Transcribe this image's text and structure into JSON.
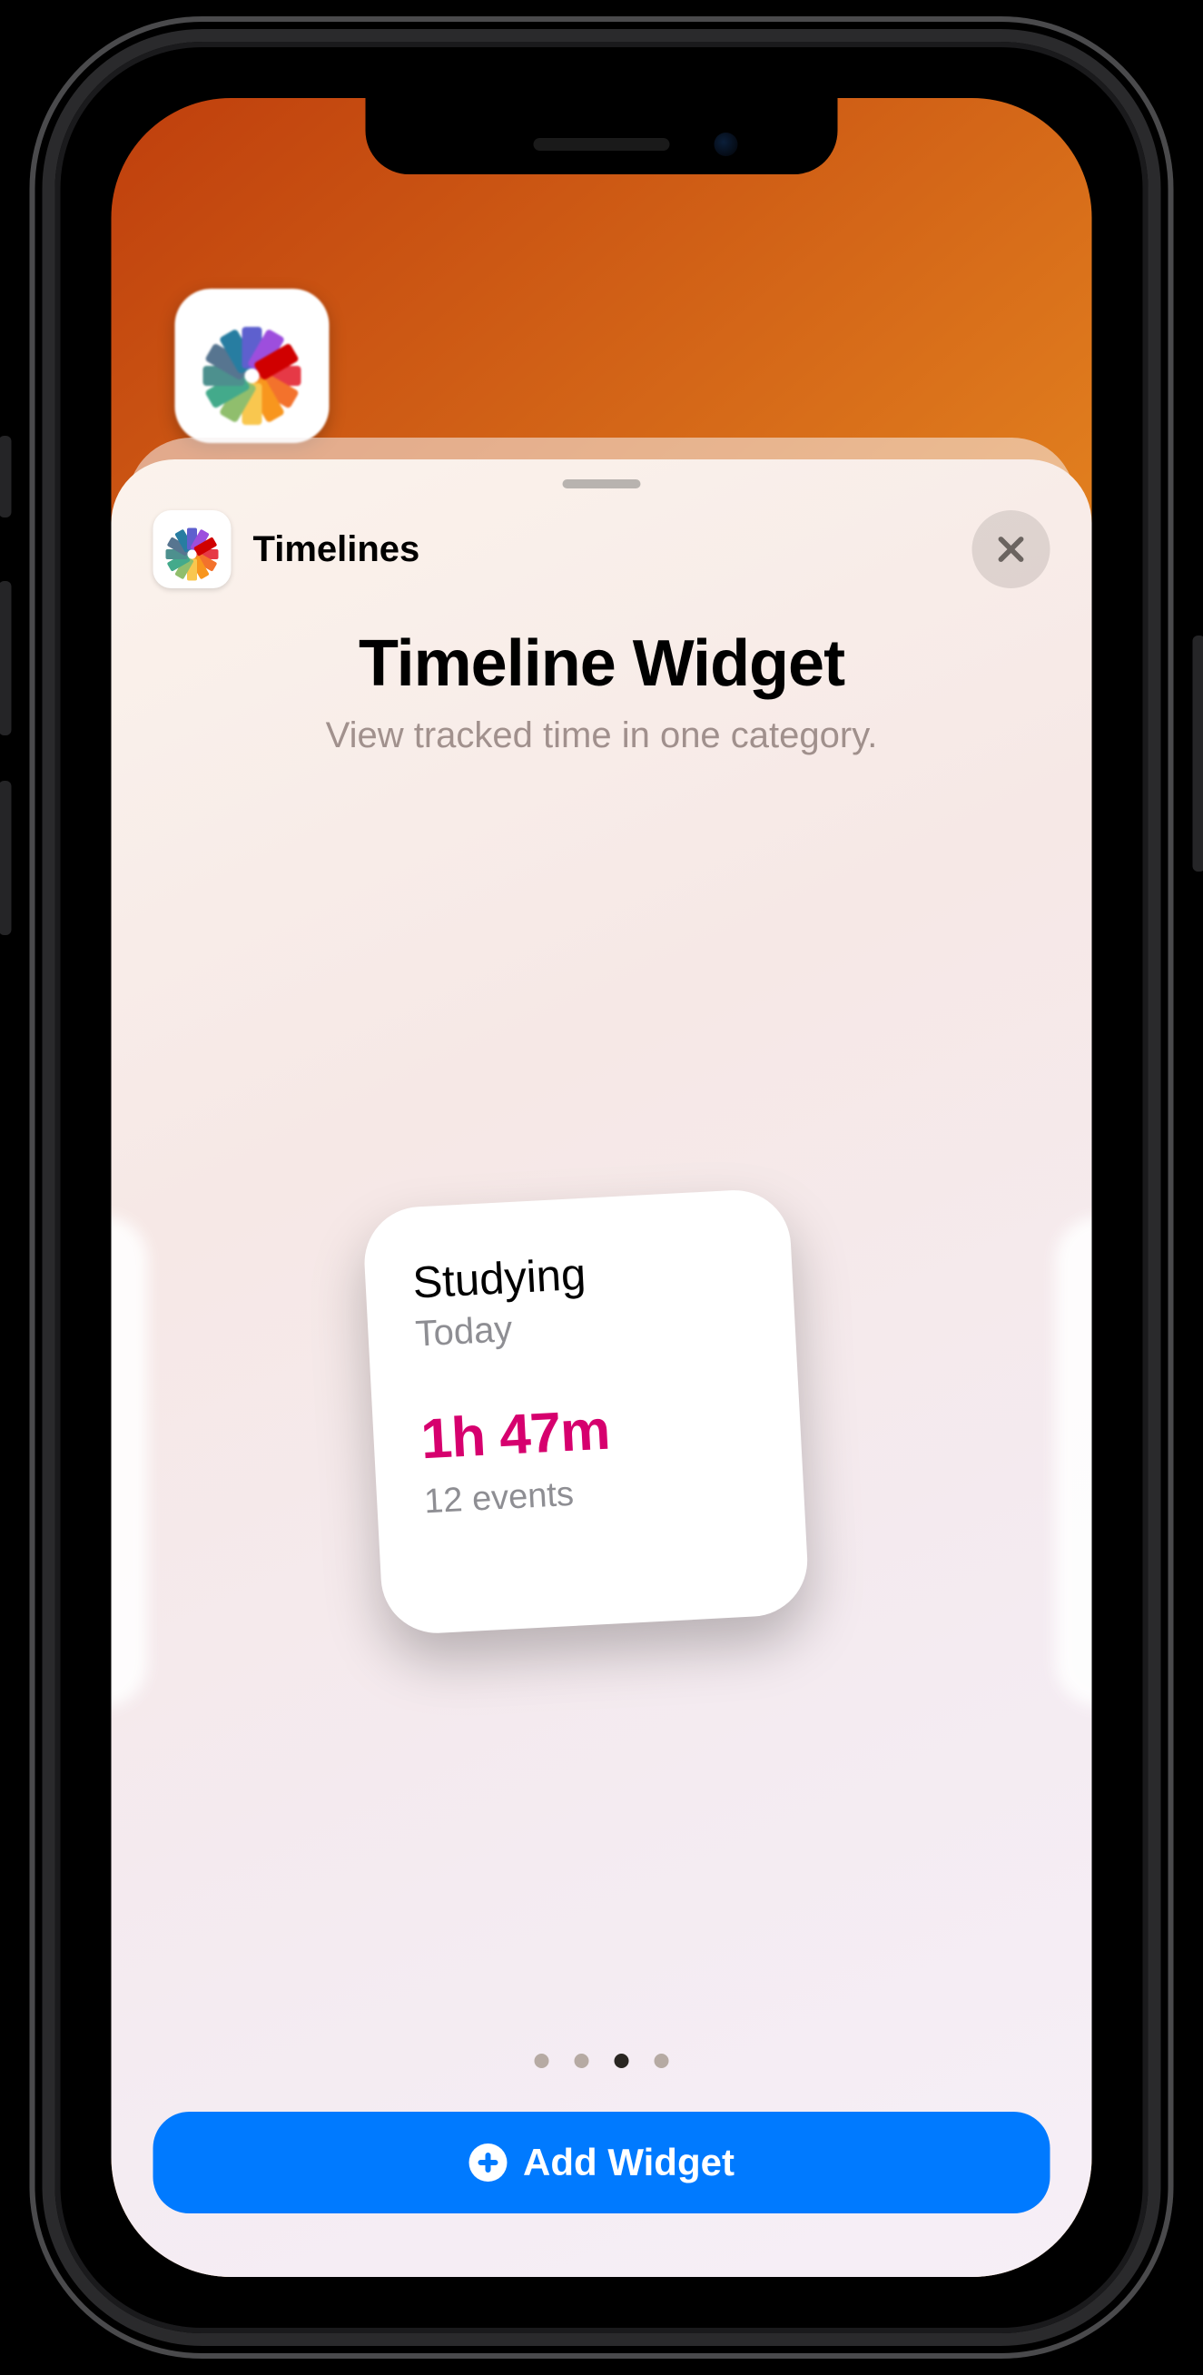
{
  "header": {
    "app_name": "Timelines"
  },
  "page": {
    "title": "Timeline Widget",
    "subtitle": "View tracked time in one category."
  },
  "widget": {
    "category": "Studying",
    "scope": "Today",
    "duration": "1h 47m",
    "event_count": "12 events",
    "accent_color": "#d6006e"
  },
  "pager": {
    "count": 4,
    "current_index": 2
  },
  "actions": {
    "add_label": "Add Widget"
  },
  "colors": {
    "primary_button": "#007aff"
  },
  "icons": {
    "app": "timelines-color-wheel",
    "close": "xmark",
    "add": "plus-circle-fill"
  }
}
